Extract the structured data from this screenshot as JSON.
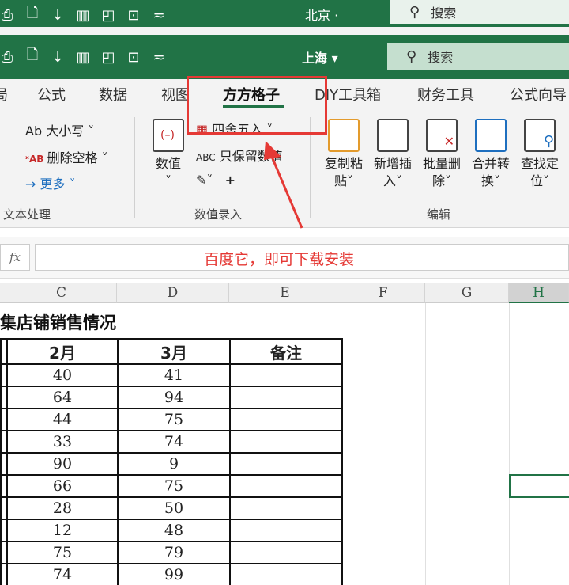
{
  "titlebar_top": {
    "city": "北京 ·",
    "search_placeholder": "搜索"
  },
  "titlebar_main": {
    "city": "上海 ▾",
    "search_placeholder": "搜索"
  },
  "tabs": [
    "局",
    "公式",
    "数据",
    "视图",
    "方方格子",
    "DIY工具箱",
    "财务工具",
    "公式向导"
  ],
  "active_tab": "方方格子",
  "ribbon": {
    "text_group": {
      "case": "Ab 大小写 ˅",
      "remove_space": "删除空格 ˅",
      "more": "→ 更多 ˅",
      "label": "文本处理"
    },
    "value_group": {
      "value_btn": "数值",
      "round": "四舍五入 ˅",
      "keep_value": "只保留数值",
      "label": "数值录入"
    },
    "edit_group": {
      "buttons": [
        "复制粘\n贴˅",
        "新增插\n入˅",
        "批量删\n除˅",
        "合并转\n换˅",
        "查找定\n位˅"
      ],
      "label": "编辑"
    }
  },
  "formula_bar": {
    "fx": "fx",
    "annotation": "百度它，即可下载安装"
  },
  "columns": [
    "C",
    "D",
    "E",
    "F",
    "G",
    "H"
  ],
  "sheet": {
    "title": "集店铺销售情况",
    "headers": [
      "2月",
      "3月",
      "备注"
    ],
    "rows": [
      [
        40,
        41
      ],
      [
        64,
        94
      ],
      [
        44,
        75
      ],
      [
        33,
        74
      ],
      [
        90,
        9
      ],
      [
        66,
        75
      ],
      [
        28,
        50
      ],
      [
        12,
        48
      ],
      [
        75,
        79
      ],
      [
        74,
        99
      ]
    ]
  },
  "colors": {
    "accent": "#217346",
    "annotation": "#e53935"
  }
}
